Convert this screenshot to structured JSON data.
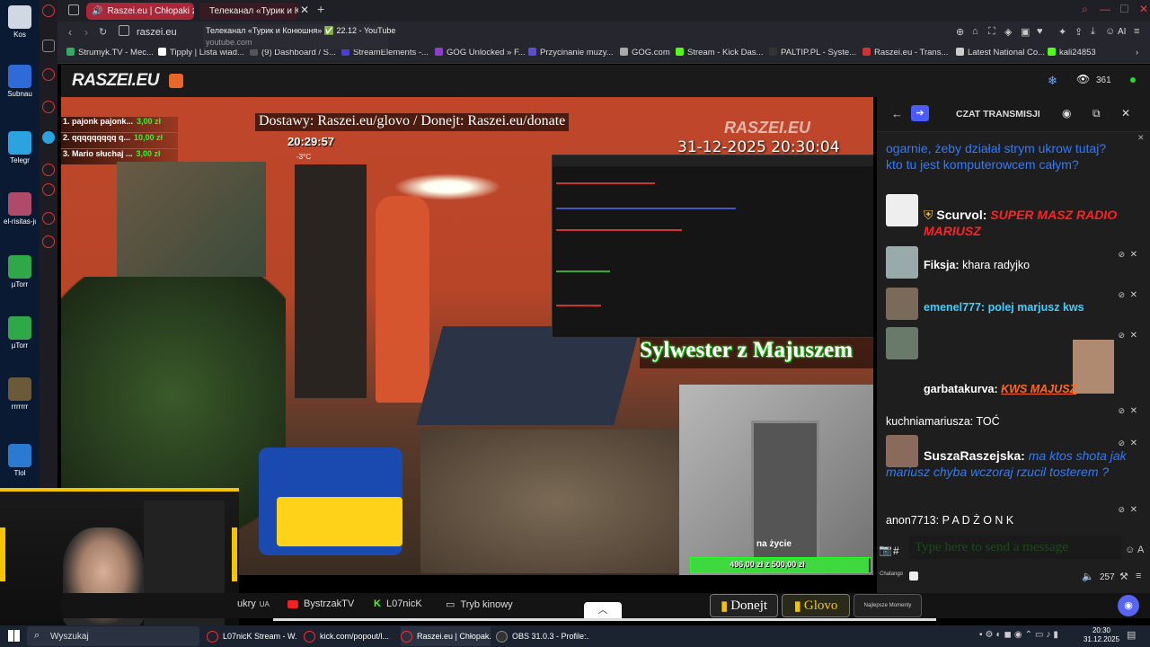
{
  "desktop": {
    "icons": [
      {
        "label": "Kos",
        "icon": "recycle-bin-icon",
        "color": "#cfd8e3"
      },
      {
        "label": "Subnau",
        "icon": "app-icon",
        "color": "#2e6bd9"
      },
      {
        "label": "Telegr",
        "icon": "telegram-icon",
        "color": "#2aa3e0"
      },
      {
        "label": "el-risitas-ju",
        "icon": "image-icon",
        "color": "#b04a6a"
      },
      {
        "label": "µTorr",
        "icon": "utorrent-icon",
        "color": "#2fa84a"
      },
      {
        "label": "µTorr",
        "icon": "utorrent-icon",
        "color": "#2fa84a"
      },
      {
        "label": "rrrrrrr",
        "icon": "image-icon",
        "color": "#6b5a3a"
      },
      {
        "label": "Tlol",
        "icon": "file-icon",
        "color": "#2a7ad1"
      }
    ]
  },
  "browser": {
    "tabs": [
      {
        "label": "Raszei.eu | Chłopaki z",
        "active": true
      },
      {
        "label": "Телеканал «Турик и К",
        "active": false
      }
    ],
    "new_tab": "+",
    "address": "raszei.eu",
    "tooltip": {
      "title": "Телеканал «Турик и Конюшня» ✅ 22.12 - YouTube",
      "url": "youtube.com"
    },
    "toolbar_ai": "AI",
    "bookmarks": [
      {
        "label": "Strumyk.TV - Mec...",
        "color": "#3a6"
      },
      {
        "label": "Tipply | Lista wiad...",
        "color": "#fff"
      },
      {
        "label": "(9) Dashboard / S...",
        "color": "#555"
      },
      {
        "label": "StreamElements -...",
        "color": "#4a3fd1"
      },
      {
        "label": "GOG Unlocked » F...",
        "color": "#8b3fc9"
      },
      {
        "label": "Przycinanie muzy...",
        "color": "#5a4fc9"
      },
      {
        "label": "GOG.com",
        "color": "#aaa"
      },
      {
        "label": "Stream - Kick Das...",
        "color": "#53fc18"
      },
      {
        "label": "PALTIP.PL - Syste...",
        "color": "#333"
      },
      {
        "label": "Raszei.eu - Trans...",
        "color": "#c33"
      },
      {
        "label": "Latest National Co...",
        "color": "#ccc"
      },
      {
        "label": "kali24853",
        "color": "#53fc18"
      }
    ]
  },
  "site": {
    "logo": "RASZEI.EU",
    "viewers": "361"
  },
  "video": {
    "top_banner": "Dostawy: Raszei.eu/glovo / Donejt: Raszei.eu/donate",
    "clock": "20:29:57",
    "temp": "-3°C",
    "watermark": "RASZEI.EU",
    "timestamp": "31-12-2025 20:30:04",
    "title_overlay": "Sylwester z Majuszem",
    "donors": [
      {
        "name": "1. pajonk pajonk...",
        "amount": "3,00 zł"
      },
      {
        "name": "2. qqqqqqqqq q...",
        "amount": "10,00 zł"
      },
      {
        "name": "3. Mario słuchaj ...",
        "amount": "3,00 zł"
      }
    ],
    "cam_label": "na życie",
    "goal": "496,00 zł z 500,00 zł",
    "goal_progress": 0.992
  },
  "chat": {
    "header": "CZAT TRANSMISJI",
    "messages": [
      {
        "user": "",
        "text": "ogarnie, żeby działał strym ukrow tutaj? kto tu jest komputerowcem całym?",
        "color": "#2f7bff"
      },
      {
        "user": "Scurvol:",
        "text": "SUPER MASZ RADIO MARIUSZ",
        "color": "#ff2222"
      },
      {
        "user": "Fiksja:",
        "text": "khara radyjko",
        "color": "#ffffff"
      },
      {
        "user": "emenel777:",
        "text": "polej marjusz kws",
        "color": "#3fd0ff"
      },
      {
        "user": "garbatakurva:",
        "text": "KWS MAJUSZ",
        "color": "#ff6a1a"
      },
      {
        "user": "kuchniamariusza:",
        "text": "TOĆ",
        "color": "#ffffff"
      },
      {
        "user": "SuszaRaszejska:",
        "text": "ma ktos shota jak mariusz chyba wczoraj rzucil tosterem ?",
        "color": "#2f7bff"
      },
      {
        "user": "anon7713:",
        "text": "P A D Ż O N K",
        "color": "#ffffff"
      }
    ],
    "input_placeholder": "Type here to send a message",
    "chatango_label": "Chatango",
    "volume": "257"
  },
  "controls": {
    "items": [
      "ukry",
      "BystrzakTV",
      "L07nicK",
      "Tryb kinowy"
    ],
    "ukry_tag": "UA",
    "donejt": "Donejt",
    "glovo": "Glovo",
    "latest": "Najlepsze Momenty"
  },
  "taskbar": {
    "search": "Wyszukaj",
    "items": [
      "L07nicK Stream - W...",
      "kick.com/popout/l...",
      "Raszei.eu | Chłopak...",
      "OBS 31.0.3 - Profile:..."
    ],
    "time": "20:30",
    "date": "31.12.2025"
  }
}
